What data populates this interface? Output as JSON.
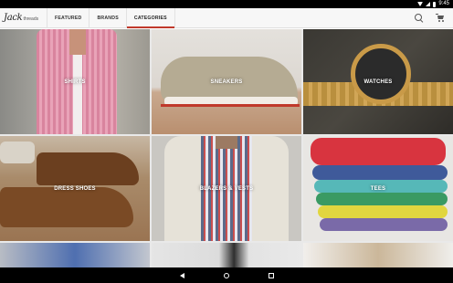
{
  "status_bar": {
    "time": "9:45"
  },
  "app": {
    "logo_script": "Jack",
    "logo_sub": "threads",
    "tabs": [
      {
        "label": "FEATURED",
        "active": false
      },
      {
        "label": "BRANDS",
        "active": false
      },
      {
        "label": "CATEGORIES",
        "active": true
      }
    ],
    "accent_color": "#c0392b"
  },
  "categories": [
    {
      "label": "SHIRTS"
    },
    {
      "label": "SNEAKERS"
    },
    {
      "label": "WATCHES"
    },
    {
      "label": "DRESS SHOES"
    },
    {
      "label": "BLAZERS & VESTS"
    },
    {
      "label": "TEES"
    }
  ]
}
